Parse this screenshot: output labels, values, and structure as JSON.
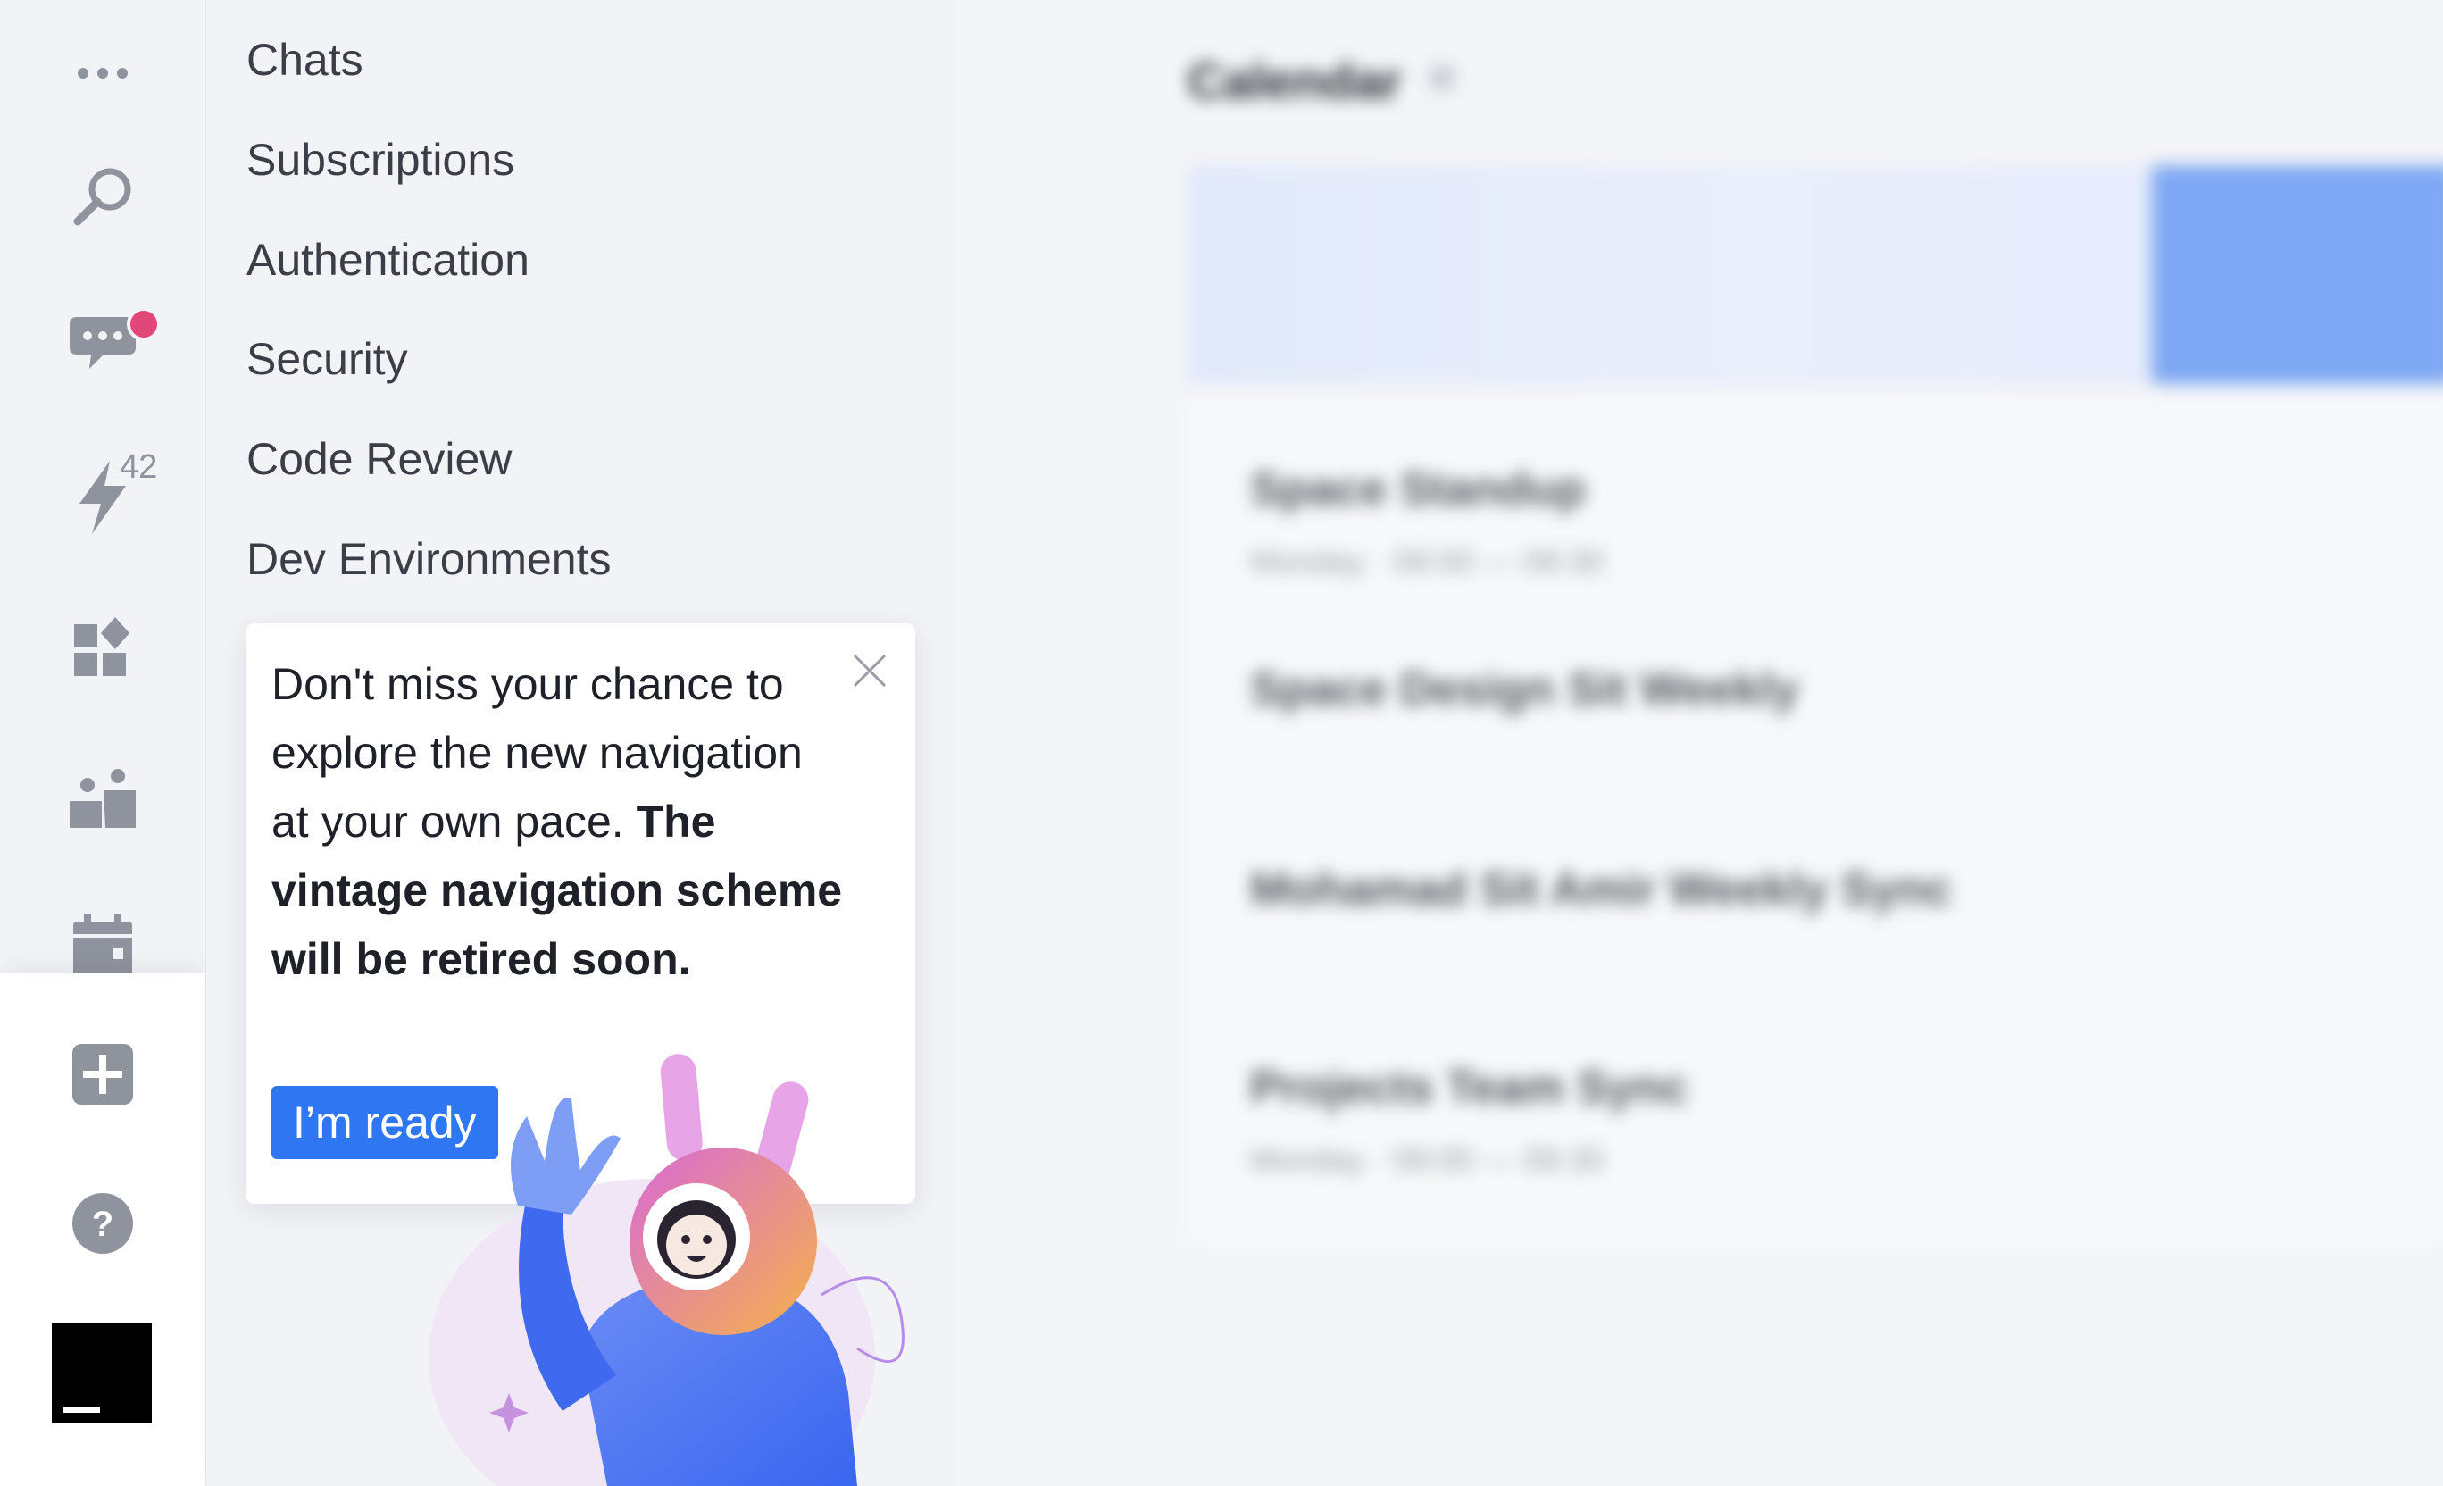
{
  "rail": {
    "items": [
      {
        "name": "more",
        "icon": "more-dots-icon"
      },
      {
        "name": "search",
        "icon": "search-icon"
      },
      {
        "name": "chats",
        "icon": "chat-bubble-icon",
        "has_notification": true
      },
      {
        "name": "automation",
        "icon": "lightning-icon",
        "count": "42"
      },
      {
        "name": "widgets",
        "icon": "widgets-icon"
      },
      {
        "name": "team",
        "icon": "team-icon"
      },
      {
        "name": "calendar",
        "icon": "calendar-icon"
      }
    ],
    "bottom": [
      {
        "name": "add",
        "icon": "plus-square-icon"
      },
      {
        "name": "help",
        "icon": "help-circle-icon"
      },
      {
        "name": "app-logo",
        "icon": "jetbrains-logo-icon"
      }
    ]
  },
  "nav": {
    "items": [
      {
        "label": "Chats"
      },
      {
        "label": "Subscriptions"
      },
      {
        "label": "Authentication"
      },
      {
        "label": "Security"
      },
      {
        "label": "Code Review"
      },
      {
        "label": "Dev Environments"
      }
    ]
  },
  "popover": {
    "text_regular": "Don't miss your chance to explore the new navigation at your own pace.",
    "text_bold": "The vintage navigation scheme will be retired soon.",
    "button_label": "I’m ready",
    "mascot": "astronaut-bunny-illustration"
  },
  "main": {
    "blurred": true,
    "title": "Calendar",
    "events": [
      {
        "title": "Space Standup",
        "subtitle": "Monday · 09:00 — 09:30"
      },
      {
        "title": "Space Design Sit Weekly",
        "subtitle": ""
      },
      {
        "title": "Mohamad Sit Amir Weekly Sync",
        "subtitle": ""
      },
      {
        "title": "Projects Team Sync",
        "subtitle": "Monday · 09:00 — 09:30"
      }
    ]
  },
  "colors": {
    "accent": "#2f77f2",
    "notification": "#e2477a",
    "icon_gray": "#8f939e",
    "nav_text": "#3b3e47"
  }
}
